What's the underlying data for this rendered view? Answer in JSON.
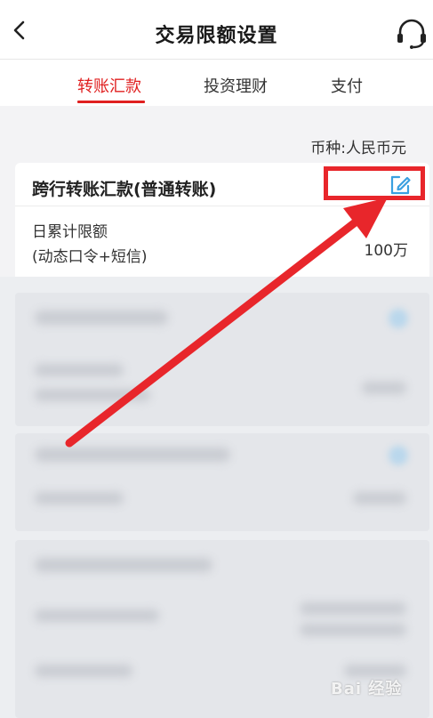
{
  "header": {
    "title": "交易限额设置"
  },
  "tabs": [
    {
      "label": "转账汇款",
      "active": true
    },
    {
      "label": "投资理财",
      "active": false
    },
    {
      "label": "支付",
      "active": false
    }
  ],
  "currency_label": "币种:人民币元",
  "card": {
    "title": "跨行转账汇款(普通转账)",
    "limit_label_line1": "日累计限额",
    "limit_label_line2": "(动态口令+短信)",
    "limit_value": "100万"
  },
  "watermark": "Bai 经验",
  "colors": {
    "accent": "#e02020",
    "highlight": "#e8262b",
    "edit_icon": "#3aa0e0"
  },
  "icons": {
    "back": "chevron-left-icon",
    "support": "headset-icon",
    "edit": "edit-icon"
  }
}
